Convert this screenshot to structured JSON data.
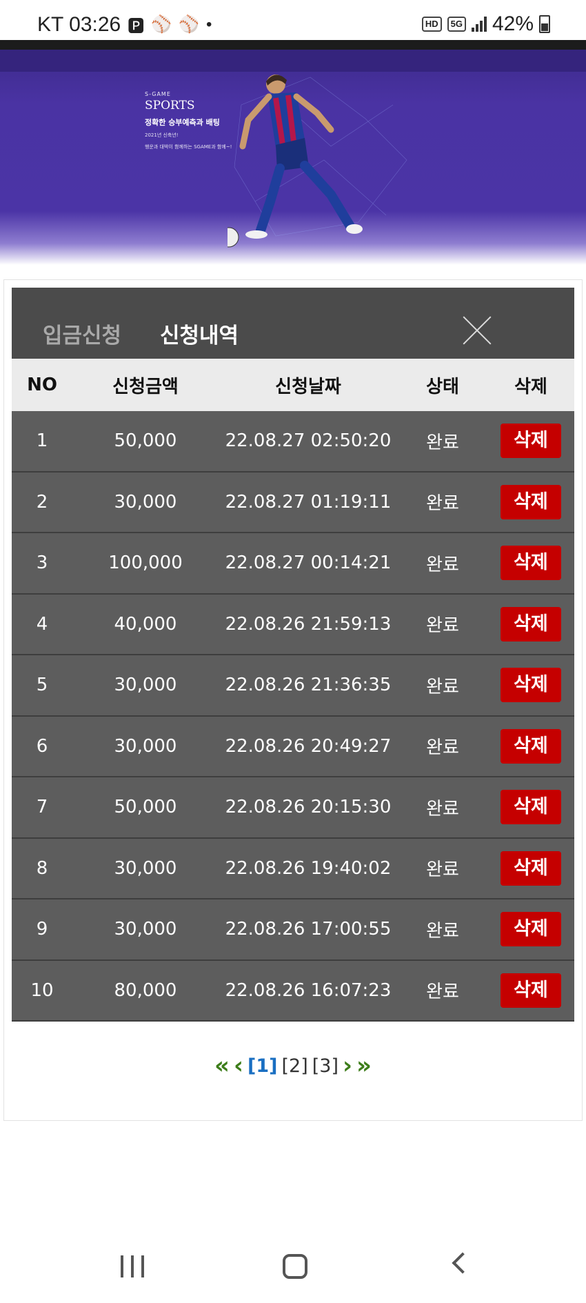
{
  "status_bar": {
    "carrier_time": "KT 03:26",
    "icons": [
      "p-icon",
      "baseball-icon",
      "baseball-icon",
      "dot-icon"
    ],
    "hd_badge": "HD",
    "network_badge": "5G",
    "battery": "42%"
  },
  "banner": {
    "brand_small": "S-GAME",
    "title": "SPORTS",
    "subtitle": "정확한 승부예측과 배팅",
    "line1": "2021년 신축년!",
    "line2": "행운과 대박이 함께하는 SGAME과 함께~!"
  },
  "tabs": {
    "deposit": "입금신청",
    "history": "신청내역"
  },
  "table": {
    "headers": [
      "NO",
      "신청금액",
      "신청날짜",
      "상태",
      "삭제"
    ],
    "rows": [
      {
        "no": "1",
        "amount": "50,000",
        "date": "22.08.27 02:50:20",
        "status": "완료",
        "action": "삭제"
      },
      {
        "no": "2",
        "amount": "30,000",
        "date": "22.08.27 01:19:11",
        "status": "완료",
        "action": "삭제"
      },
      {
        "no": "3",
        "amount": "100,000",
        "date": "22.08.27 00:14:21",
        "status": "완료",
        "action": "삭제"
      },
      {
        "no": "4",
        "amount": "40,000",
        "date": "22.08.26 21:59:13",
        "status": "완료",
        "action": "삭제"
      },
      {
        "no": "5",
        "amount": "30,000",
        "date": "22.08.26 21:36:35",
        "status": "완료",
        "action": "삭제"
      },
      {
        "no": "6",
        "amount": "30,000",
        "date": "22.08.26 20:49:27",
        "status": "완료",
        "action": "삭제"
      },
      {
        "no": "7",
        "amount": "50,000",
        "date": "22.08.26 20:15:30",
        "status": "완료",
        "action": "삭제"
      },
      {
        "no": "8",
        "amount": "30,000",
        "date": "22.08.26 19:40:02",
        "status": "완료",
        "action": "삭제"
      },
      {
        "no": "9",
        "amount": "30,000",
        "date": "22.08.26 17:00:55",
        "status": "완료",
        "action": "삭제"
      },
      {
        "no": "10",
        "amount": "80,000",
        "date": "22.08.26 16:07:23",
        "status": "완료",
        "action": "삭제"
      }
    ]
  },
  "pagination": {
    "first": "«",
    "prev": "‹",
    "pages": [
      "[1]",
      "[2]",
      "[3]"
    ],
    "current_page": "[1]",
    "next": "›",
    "last": "»"
  },
  "colors": {
    "banner_purple": "#4b34a6",
    "panel_gray": "#5d5d5d",
    "delete_red": "#c50000",
    "pager_green": "#3d7d1a",
    "active_page_blue": "#1a6fc2"
  }
}
